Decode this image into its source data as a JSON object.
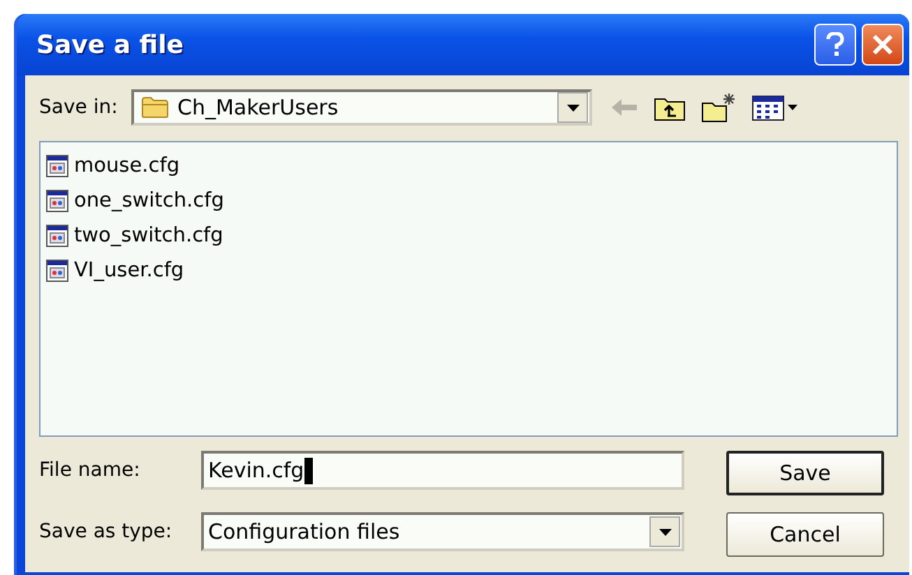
{
  "window": {
    "title": "Save a file"
  },
  "save_in": {
    "label": "Save in:",
    "value": "Ch_MakerUsers"
  },
  "files": [
    {
      "name": "mouse.cfg",
      "selected": false
    },
    {
      "name": "one_switch.cfg",
      "selected": false
    },
    {
      "name": "two_switch.cfg",
      "selected": false
    },
    {
      "name": "VI_user.cfg",
      "selected": false
    }
  ],
  "file_name": {
    "label": "File name:",
    "value": "Kevin.cfg"
  },
  "save_as_type": {
    "label": "Save as type:",
    "value": "Configuration files"
  },
  "buttons": [
    {
      "label": "Save",
      "kind": "default"
    },
    {
      "label": "Cancel",
      "kind": "normal"
    }
  ]
}
